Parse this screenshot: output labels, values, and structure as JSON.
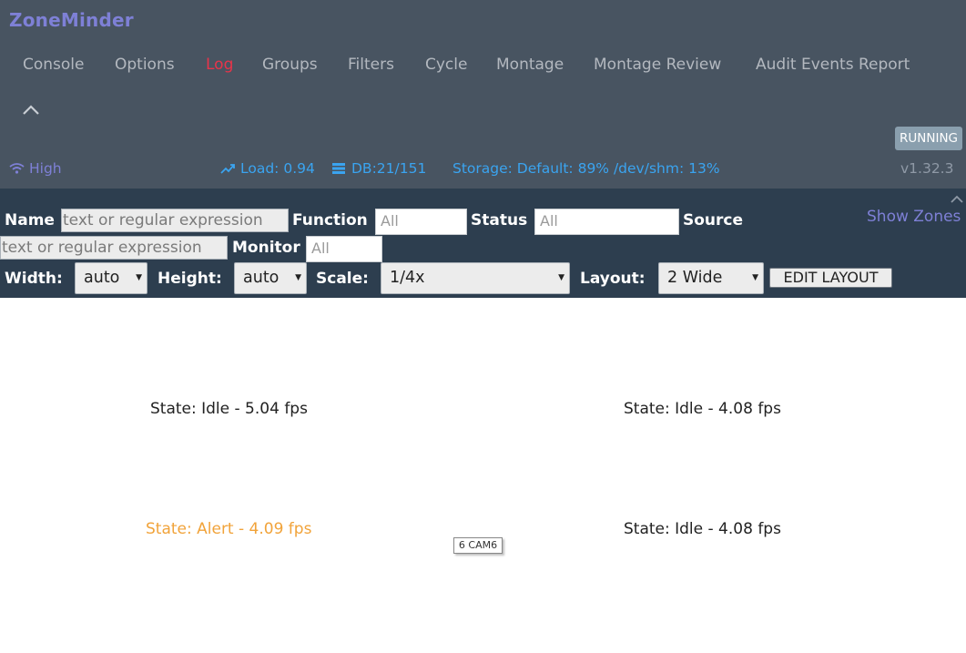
{
  "app": {
    "brand": "ZoneMinder"
  },
  "nav": {
    "items": [
      {
        "label": "Console",
        "active": false
      },
      {
        "label": "Options",
        "active": false
      },
      {
        "label": "Log",
        "active": true
      },
      {
        "label": "Groups",
        "active": false
      },
      {
        "label": "Filters",
        "active": false
      },
      {
        "label": "Cycle",
        "active": false
      },
      {
        "label": "Montage",
        "active": false
      },
      {
        "label": "Montage Review",
        "active": false
      },
      {
        "label": "Audit Events Report",
        "active": false
      }
    ],
    "collapse_icon": "chevron-up-icon"
  },
  "status": {
    "running_label": "RUNNING",
    "bandwidth_label": "High",
    "bandwidth_icon": "wifi-icon",
    "load_label": "Load: 0.94",
    "load_icon": "trending-up-icon",
    "db_label": "DB:21/151",
    "db_icon": "database-icon",
    "storage_label": "Storage: Default: 89% /dev/shm: 13%",
    "version": "v1.32.3"
  },
  "filters": {
    "name_label": "Name",
    "name_placeholder": "text or regular expression",
    "function_label": "Function",
    "function_value": "All",
    "status_label": "Status",
    "status_value": "All",
    "source_label": "Source",
    "source_placeholder": "text or regular expression",
    "monitor_label": "Monitor",
    "monitor_value": "All",
    "show_zones_label": "Show Zones"
  },
  "controls": {
    "width_label": "Width:",
    "width_value": "auto",
    "height_label": "Height:",
    "height_value": "auto",
    "scale_label": "Scale:",
    "scale_value": "1/4x",
    "layout_label": "Layout:",
    "layout_value": "2 Wide",
    "edit_layout_label": "EDIT LAYOUT"
  },
  "monitors": [
    {
      "state": "State: Idle - 5.04 fps",
      "status": "idle"
    },
    {
      "state": "State: Idle - 4.08 fps",
      "status": "idle"
    },
    {
      "state": "State: Alert - 4.09 fps",
      "status": "alert"
    },
    {
      "state": "State: Idle - 4.08 fps",
      "status": "idle"
    }
  ],
  "tooltip": "6 CAM6",
  "colors": {
    "header_bg": "#485461",
    "filter_bg": "#2d3e4f",
    "brand": "#7e80d6",
    "active_nav": "#e8344a",
    "status_blue": "#3aa4f0",
    "alert": "#f1a33a"
  }
}
